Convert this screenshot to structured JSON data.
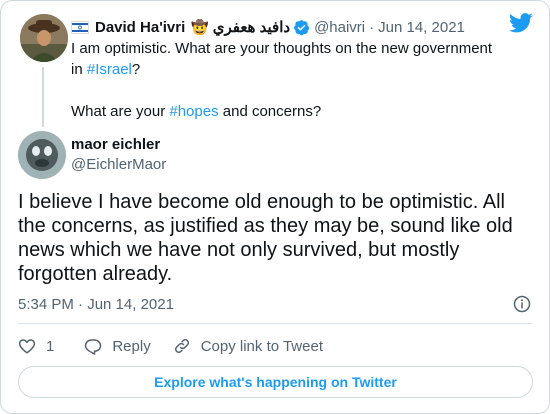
{
  "parent_tweet": {
    "display_name": "David Ha'ivri",
    "emoji": "🤠",
    "arabic_name": "دافيد هعفري",
    "handle": "@haivri",
    "separator": "·",
    "date": "Jun 14, 2021",
    "text_line1": "I am optimistic. What are your thoughts on the new government in",
    "hashtag_israel": "#Israel",
    "after_israel": "?",
    "text_line2_before": "What are your ",
    "hashtag_hopes": "#hopes",
    "text_line2_after": " and concerns?"
  },
  "main_tweet": {
    "display_name": "maor eichler",
    "handle": "@EichlerMaor",
    "text": "I believe I have become old enough to be optimistic. All the concerns, as justified as they may be, sound like old news which we have not only survived, but mostly forgotten already.",
    "timestamp": "5:34 PM · Jun 14, 2021"
  },
  "actions": {
    "like_count": "1",
    "reply_label": "Reply",
    "copy_link_label": "Copy link to Tweet"
  },
  "explore_label": "Explore what's happening on Twitter",
  "colors": {
    "accent": "#1d9bf0",
    "text": "#0f1419",
    "muted": "#536471",
    "border": "#cfd9de"
  },
  "icons": {
    "logo": "twitter-bird-icon",
    "verified": "verified-badge-icon",
    "info": "info-icon",
    "like": "heart-icon",
    "reply": "reply-bubble-icon",
    "copy": "link-icon",
    "flag": "israel-flag-icon"
  }
}
